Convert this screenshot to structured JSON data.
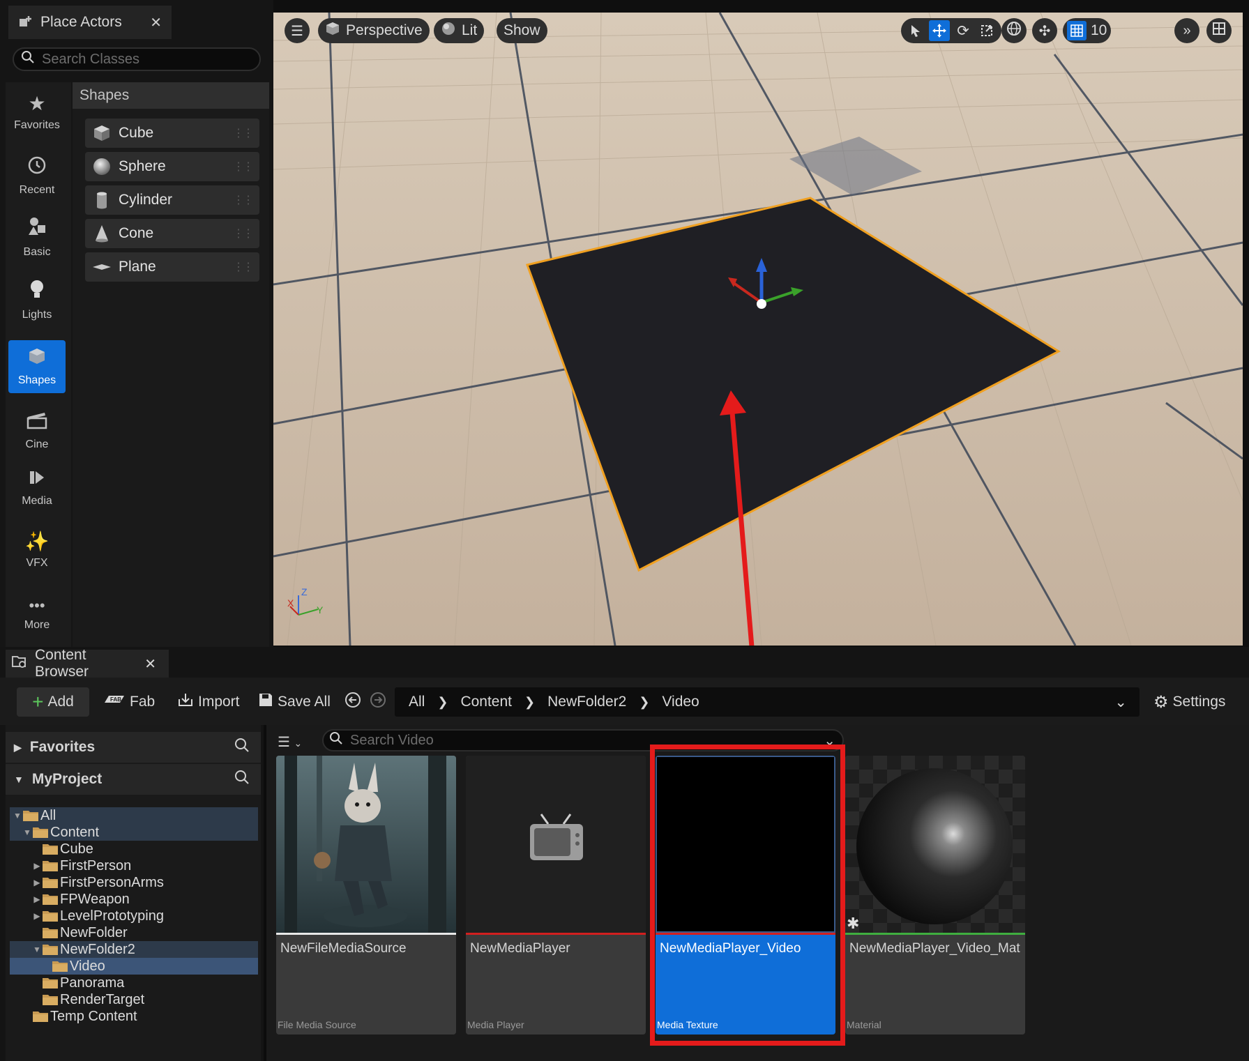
{
  "place_actors": {
    "tab_title": "Place Actors",
    "search_placeholder": "Search Classes",
    "categories": [
      {
        "label": "Favorites",
        "icon": "star-icon"
      },
      {
        "label": "Recent",
        "icon": "clock-icon"
      },
      {
        "label": "Basic",
        "icon": "basic-shapes-icon"
      },
      {
        "label": "Lights",
        "icon": "lightbulb-icon"
      },
      {
        "label": "Shapes",
        "icon": "cube-icon",
        "active": true
      },
      {
        "label": "Cine",
        "icon": "clapperboard-icon"
      },
      {
        "label": "Media",
        "icon": "media-play-icon"
      },
      {
        "label": "VFX",
        "icon": "sparkles-icon"
      },
      {
        "label": "More",
        "icon": "ellipsis-icon"
      }
    ],
    "section_title": "Shapes",
    "shapes": [
      "Cube",
      "Sphere",
      "Cylinder",
      "Cone",
      "Plane"
    ]
  },
  "viewport": {
    "menu_icon": "hamburger-icon",
    "perspective_label": "Perspective",
    "lit_label": "Lit",
    "show_label": "Show",
    "grid_snap_value": "10",
    "axis_labels": {
      "x": "X",
      "y": "Y",
      "z": "Z"
    }
  },
  "content_browser": {
    "tab_title": "Content Browser",
    "toolbar": {
      "add_label": "Add",
      "fab_label": "Fab",
      "import_label": "Import",
      "save_all_label": "Save All",
      "settings_label": "Settings"
    },
    "breadcrumb": [
      "All",
      "Content",
      "NewFolder2",
      "Video"
    ],
    "favorites_label": "Favorites",
    "project_label": "MyProject",
    "tree": [
      {
        "label": "All",
        "depth": 0,
        "twisty": "open"
      },
      {
        "label": "Content",
        "depth": 1,
        "twisty": "open"
      },
      {
        "label": "Cube",
        "depth": 2,
        "twisty": ""
      },
      {
        "label": "FirstPerson",
        "depth": 2,
        "twisty": "closed"
      },
      {
        "label": "FirstPersonArms",
        "depth": 2,
        "twisty": "closed"
      },
      {
        "label": "FPWeapon",
        "depth": 2,
        "twisty": "closed"
      },
      {
        "label": "LevelPrototyping",
        "depth": 2,
        "twisty": "closed"
      },
      {
        "label": "NewFolder",
        "depth": 2,
        "twisty": ""
      },
      {
        "label": "NewFolder2",
        "depth": 2,
        "twisty": "open"
      },
      {
        "label": "Video",
        "depth": 3,
        "twisty": ""
      },
      {
        "label": "Panorama",
        "depth": 2,
        "twisty": ""
      },
      {
        "label": "RenderTarget",
        "depth": 2,
        "twisty": ""
      },
      {
        "label": "Temp Content",
        "depth": 1,
        "twisty": ""
      }
    ],
    "search_placeholder": "Search Video",
    "assets": [
      {
        "name": "NewFileMediaSource",
        "type": "File Media Source",
        "bar_color": "#e8e8e8"
      },
      {
        "name": "NewMediaPlayer",
        "type": "Media Player",
        "bar_color": "#d21f1f"
      },
      {
        "name": "NewMediaPlayer_Video",
        "type": "Media Texture",
        "bar_color": "#d21f1f",
        "selected": true
      },
      {
        "name": "NewMediaPlayer_Video_Mat",
        "type": "Material",
        "bar_color": "#3fae3f"
      }
    ]
  },
  "colors": {
    "accent": "#0f6ed8",
    "annotation": "#e41b1b",
    "selection_outline": "#f0a020"
  }
}
